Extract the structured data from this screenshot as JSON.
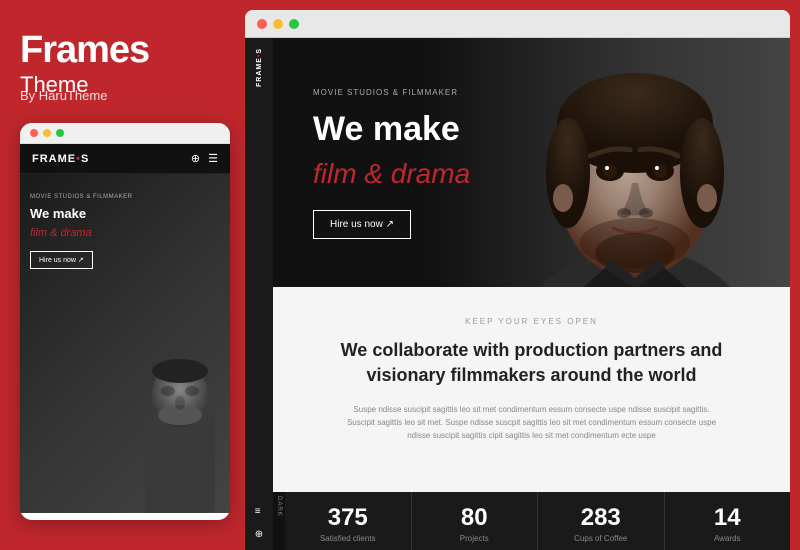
{
  "left": {
    "title": "Frames",
    "subtitle": "Theme",
    "author": "By HaruTheme"
  },
  "mobile": {
    "logo": "FRAME",
    "logo_dot": "•",
    "logo_suffix": "S",
    "tag": "MOVIE STUDIOS & FILMMAKER",
    "headline": "We make",
    "subheadline": "film & drama",
    "cta": "Hire us now ↗"
  },
  "desktop": {
    "logo": "FRAME",
    "logo_dot": "•",
    "logo_suffix": "S",
    "tag": "MOVIE STUDIOS & FILMMAKER",
    "headline_line1": "We make",
    "subheadline": "film & drama",
    "cta": "Hire us now ↗",
    "section2_eyebrow": "KEEP YOUR EYES OPEN",
    "section2_headline": "We collaborate with production partners and visionary filmmakers around the world",
    "section2_body": "Suspe ndisse suscipit sagittis leo sit met condimentum essum consecte uspe ndisse suscipit sagittis. Suscipit sagittis leo sit met. Suspe ndisse suscpit sagittis leo sit met condimentum essum consecte uspe ndisse suscipit sagittis cipit sagittis leo sit met condimentum ecte uspe",
    "dark_label": "Dark",
    "stats": [
      {
        "number": "375",
        "label": "Satisfied clients"
      },
      {
        "number": "80",
        "label": "Projects"
      },
      {
        "number": "283",
        "label": "Cups of Coffee"
      },
      {
        "number": "14",
        "label": "Awards"
      }
    ]
  },
  "colors": {
    "accent": "#c0272d",
    "dark_bg": "#1a1a1a",
    "light_bg": "#f5f5f5"
  }
}
